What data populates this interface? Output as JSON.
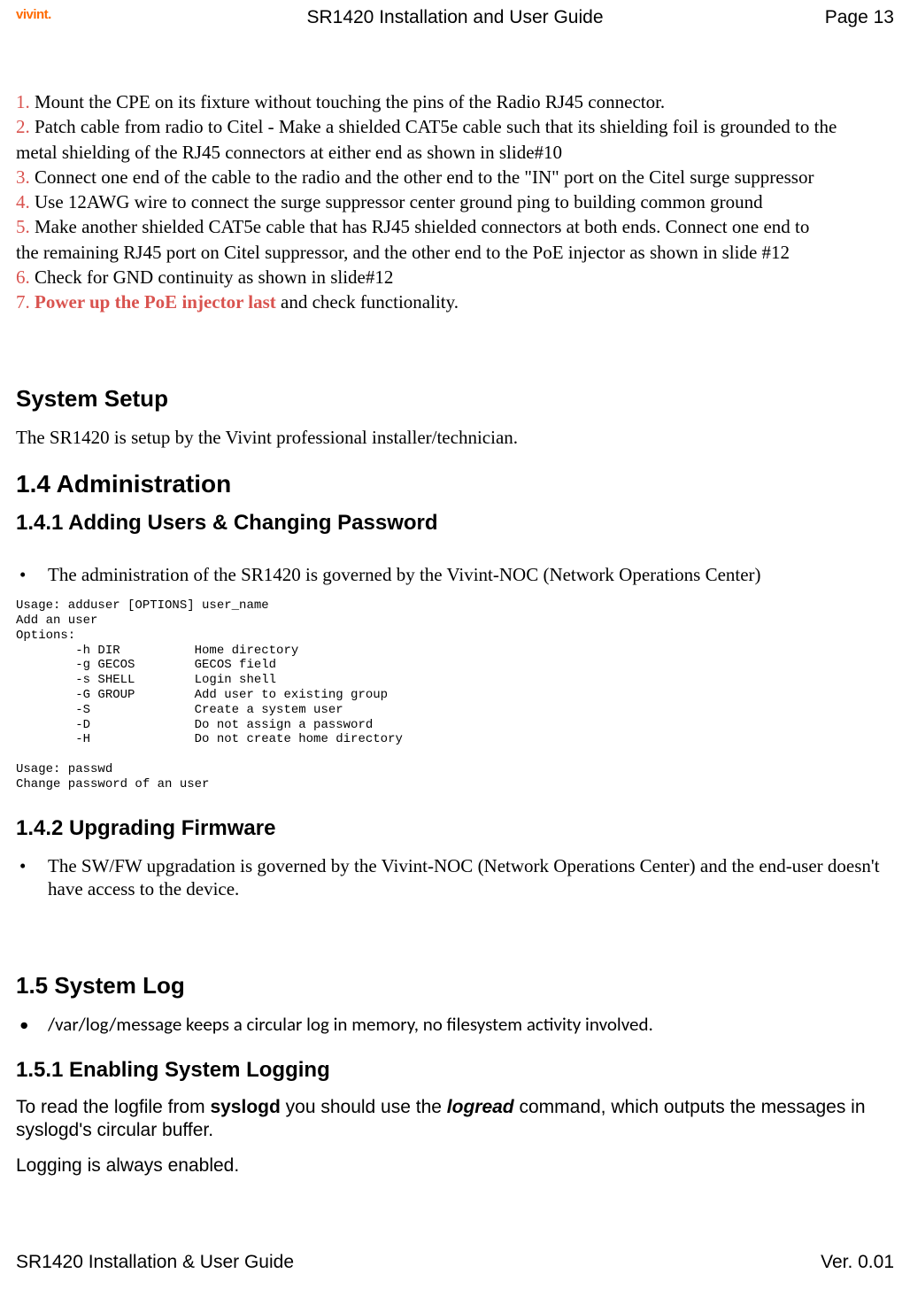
{
  "header": {
    "logo": "vivint.",
    "title": "SR1420 Installation and User Guide",
    "page": "Page 13"
  },
  "steps": {
    "n1": "1.",
    "t1": "    Mount the CPE on its fixture without touching the pins of the Radio RJ45 connector.",
    "n2": "2.",
    "t2a": "    Patch cable from radio to Citel - Make a shielded CAT5e cable such that its shielding foil is grounded to the",
    "t2b": "metal shielding of the RJ45 connectors at either end as shown in slide#10",
    "n3": "3.",
    "t3": "    Connect one end of the cable to the radio and the other end to the \"IN\" port on the Citel surge suppressor",
    "n4": "4.",
    "t4": "    Use 12AWG wire to connect the surge suppressor center ground ping to building common ground",
    "n5": "5.",
    "t5a": "    Make another shielded CAT5e cable that has RJ45 shielded connectors at both ends. Connect one end to",
    "t5b": "the remaining RJ45 port on Citel suppressor, and the other end to the PoE injector as shown in slide #12",
    "n6": "6.",
    "t6": "    Check for GND continuity as shown in slide#12",
    "n7": "7.",
    "t7r": "Power up the PoE injector last",
    "t7": " and check functionality."
  },
  "setup": {
    "heading": "System Setup",
    "text": "The SR1420 is setup by the Vivint professional installer/technician."
  },
  "admin": {
    "heading": "1.4    Administration",
    "sub1": "1.4.1 Adding Users & Changing Password",
    "bullet1": "The administration of the SR1420 is governed by the Vivint-NOC (Network Operations Center)",
    "code": "Usage: adduser [OPTIONS] user_name\nAdd an user\nOptions:\n        -h DIR          Home directory\n        -g GECOS        GECOS field\n        -s SHELL        Login shell\n        -G GROUP        Add user to existing group\n        -S              Create a system user\n        -D              Do not assign a password\n        -H              Do not create home directory\n\nUsage: passwd\nChange password of an user",
    "sub2": "1.4.2 Upgrading Firmware",
    "bullet2": "The SW/FW upgradation is governed by the Vivint-NOC (Network Operations Center) and the end-user doesn't have access to the device."
  },
  "syslog": {
    "heading": "1.5    System Log",
    "bullet": "/var/log/message keeps a circular log in memory, no filesystem activity involved.",
    "sub": "1.5.1 Enabling System Logging",
    "para1a": "To read the logfile from ",
    "para1b": "syslogd",
    "para1c": " you should use the ",
    "para1d": "logread",
    "para1e": " command, which outputs the messages in syslogd's circular buffer.",
    "para2": "Logging is always enabled."
  },
  "footer": {
    "left": "SR1420 Installation & User Guide",
    "right": "Ver. 0.01"
  }
}
